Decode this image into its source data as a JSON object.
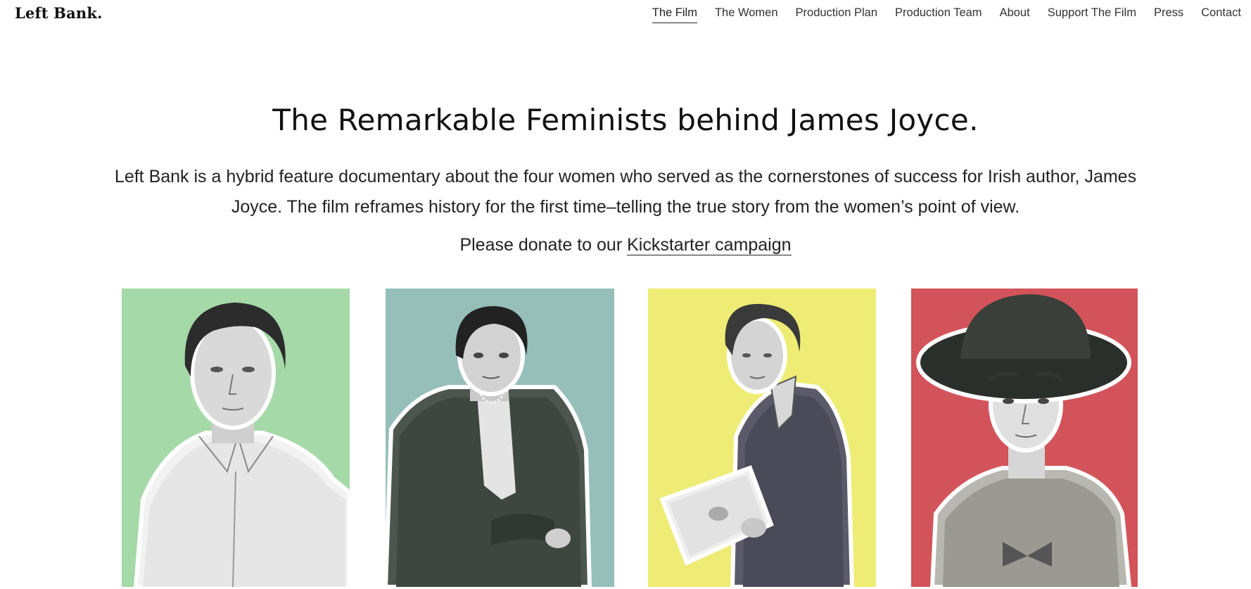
{
  "site": {
    "logo": "Left Bank."
  },
  "nav": {
    "items": [
      {
        "label": "The Film",
        "active": true
      },
      {
        "label": "The Women",
        "active": false
      },
      {
        "label": "Production Plan",
        "active": false
      },
      {
        "label": "Production Team",
        "active": false
      },
      {
        "label": "About",
        "active": false
      },
      {
        "label": "Support The Film",
        "active": false
      },
      {
        "label": "Press",
        "active": false
      },
      {
        "label": "Contact",
        "active": false
      }
    ]
  },
  "hero": {
    "headline": "The Remarkable Feminists behind James Joyce.",
    "intro": "Left Bank is a hybrid feature documentary about the four women who served as the cornerstones of success for Irish author, James Joyce. The film reframes history for the first time–telling the true story from the women’s point of view.",
    "donate_prefix": "Please donate to our ",
    "donate_link": "Kickstarter campaign"
  },
  "portraits": [
    {
      "background": "#a5d9a8"
    },
    {
      "background": "#96bfba"
    },
    {
      "background": "#eeec74"
    },
    {
      "background": "#d2545a"
    }
  ]
}
